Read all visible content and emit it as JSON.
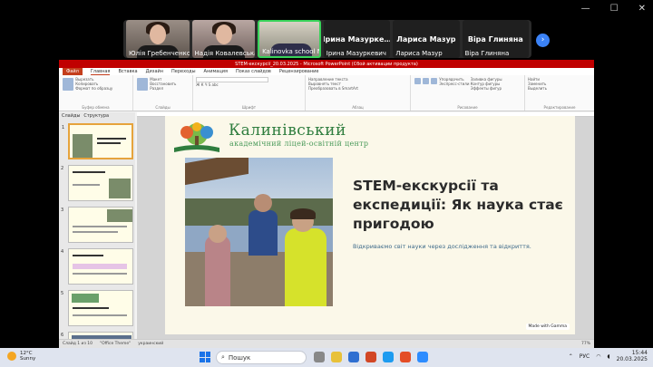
{
  "window_controls": [
    "—",
    "☐",
    "✕"
  ],
  "participants": [
    {
      "name": "Юлія Гребенченко",
      "type": "video"
    },
    {
      "name": "Надія Ковалевська",
      "type": "video"
    },
    {
      "name": "Kalinovka school No1",
      "type": "video",
      "speaking": true
    },
    {
      "name": "Ірина Мазуркевич",
      "big_name": "Ірина Мазурке…",
      "type": "name"
    },
    {
      "name": "Лариса Мазур",
      "big_name": "Лариса Мазур",
      "type": "name"
    },
    {
      "name": "Віра Глиняна",
      "big_name": "Віра Глиняна",
      "type": "name"
    }
  ],
  "next_button": "›",
  "ppt": {
    "title": "STEM-екскурсії_20.03.2025 - Microsoft PowerPoint (Сбой активации продукта)",
    "menu": [
      "Файл",
      "Главная",
      "Вставка",
      "Дизайн",
      "Переходы",
      "Анимация",
      "Показ слайдов",
      "Рецензирование"
    ],
    "active_menu": "Главная",
    "ribbon_groups": [
      {
        "caption": "Буфер обмена",
        "lines": [
          "Вырезать",
          "Копировать",
          "Формат по образцу"
        ]
      },
      {
        "caption": "Слайды",
        "lines": [
          "Макет",
          "Восстановить",
          "Раздел"
        ]
      },
      {
        "caption": "Шрифт",
        "lines": [
          "A A",
          "Ж К Ч S abc"
        ]
      },
      {
        "caption": "Абзац",
        "lines": [
          "Направление текста",
          "Выровнять текст",
          "Преобразовать в SmartArt"
        ]
      },
      {
        "caption": "Рисование",
        "lines": [
          "Упорядочить",
          "Экспресс-стили",
          "Заливка фигуры",
          "Контур фигуры",
          "Эффекты фигур"
        ]
      },
      {
        "caption": "Редактирование",
        "lines": [
          "Найти",
          "Заменить",
          "Выделить"
        ]
      }
    ],
    "pane_tabs": [
      "Слайды",
      "Структура"
    ],
    "thumbnails": [
      "1",
      "2",
      "3",
      "4",
      "5",
      "6"
    ],
    "status": {
      "slide": "Слайд 1 из 10",
      "theme": "\"Office Theme\"",
      "lang": "украинский",
      "zoom": "77%"
    }
  },
  "slide": {
    "logo_title": "Калинівський",
    "logo_sub": "академічний ліцей-освітній центр",
    "heading": "STEM-екскурсії та експедиції: Як наука стає пригодою",
    "subtext": "Відкриваємо світ науки через дослідження та відкриття.",
    "badge": "Made with Gamma"
  },
  "taskbar": {
    "temp": "12°C",
    "weather": "Sunny",
    "search_placeholder": "Пошук",
    "lang": "РУС",
    "time": "15:44",
    "date": "20.03.2025"
  }
}
